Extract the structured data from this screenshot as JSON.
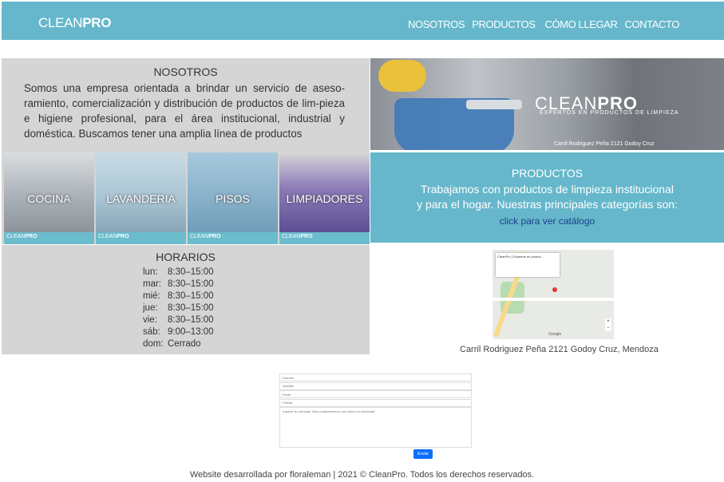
{
  "header": {
    "logo_light": "CLEAN",
    "logo_bold": "PRO",
    "nav": [
      "NOSOTROS",
      "PRODUCTOS",
      "CÓMO LLEGAR",
      "CONTACTO"
    ]
  },
  "nosotros": {
    "title": "NOSOTROS",
    "text": "Somos una empresa orientada a brindar un servicio de aseso-ramiento, comercialización y distribución de productos de lim-pieza e higiene profesional, para el área institucional, industrial y doméstica. Buscamos tener una amplia línea de productos"
  },
  "hero": {
    "brand_light": "CLEAN",
    "brand_bold": "PRO",
    "tagline": "EXPERTOS EN PRODUCTOS DE LIMPIEZA",
    "address": "Carril Rodriguez Peña 2121 Godoy Cruz"
  },
  "categories": [
    {
      "label": "COCINA"
    },
    {
      "label": "LAVANDERIA"
    },
    {
      "label": "PISOS"
    },
    {
      "label": "LIMPIADORES"
    }
  ],
  "category_mark": {
    "light": "CLEAN",
    "bold": "PRO"
  },
  "productos": {
    "title": "PRODUCTOS",
    "line1": "Trabajamos con productos de limpieza institucional",
    "line2": "y para el hogar. Nuestras principales categorías son:",
    "link": "click para ver catálogo"
  },
  "horarios": {
    "title": "HORARIOS",
    "rows": [
      {
        "day": "lun:",
        "time": "8:30–15:00"
      },
      {
        "day": "mar:",
        "time": "8:30–15:00"
      },
      {
        "day": "mié:",
        "time": "8:30–15:00"
      },
      {
        "day": "jue:",
        "time": "8:30–15:00"
      },
      {
        "day": "vie:",
        "time": "8:30–15:00"
      },
      {
        "day": "sáb:",
        "time": "9:00–13:00"
      },
      {
        "day": "dom:",
        "time": "Cerrado"
      }
    ]
  },
  "map": {
    "card_title": "CleanPro | Expertos en produc...",
    "zoom_in": "+",
    "zoom_out": "−",
    "google": "Google",
    "address": "Carril Rodriguez Peña 2121 Godoy Cruz, Mendoza"
  },
  "form": {
    "nombre_placeholder": "Nombre",
    "apellido_placeholder": "Apellido",
    "email_placeholder": "Email",
    "celular_placeholder": "Celular",
    "mensaje_placeholder": "Ingrese su mensaje. Nos contactaremos con usted a la brevedad.",
    "send": "Enviar"
  },
  "footer": {
    "text": "Website desarrollada por floraleman | 2021 © CleanPro. Todos los derechos reservados."
  },
  "colors": {
    "accent": "#66b7cb",
    "panel": "#d5d5d5",
    "link": "#1a3e8c",
    "button": "#0d6efd"
  }
}
